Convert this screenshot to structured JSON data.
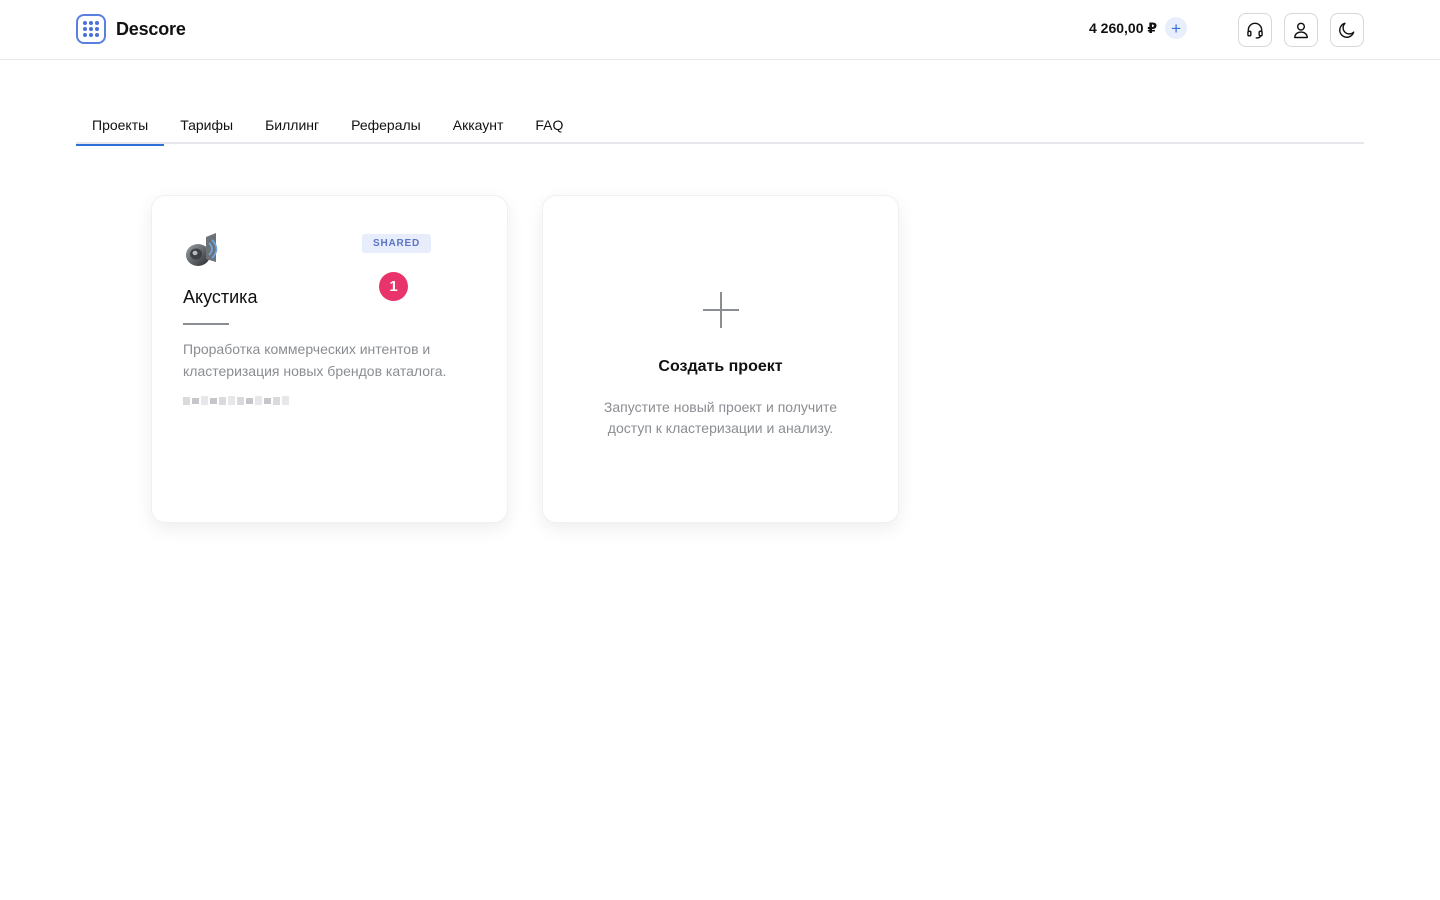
{
  "header": {
    "app_name": "Descore",
    "balance": "4 260,00 ₽",
    "balance_add_icon": "plus-icon",
    "actions": [
      {
        "icon": "headset-icon"
      },
      {
        "icon": "user-icon"
      },
      {
        "icon": "moon-icon"
      }
    ]
  },
  "tabs": [
    {
      "label": "Проекты",
      "active": true
    },
    {
      "label": "Тарифы",
      "active": false
    },
    {
      "label": "Биллинг",
      "active": false
    },
    {
      "label": "Рефералы",
      "active": false
    },
    {
      "label": "Аккаунт",
      "active": false
    },
    {
      "label": "FAQ",
      "active": false
    }
  ],
  "projects": [
    {
      "icon": "speaker-icon",
      "badge": "SHARED",
      "count": "1",
      "title": "Акустика",
      "description": "Проработка коммерческих интентов и кластеризация новых брендов каталога."
    }
  ],
  "create_card": {
    "icon": "plus-icon",
    "title": "Создать проект",
    "description": "Запустите новый проект и получите доступ к кластеризации и анализу."
  },
  "colors": {
    "accent": "#2f6fd8",
    "badge_bg": "#e8edfb",
    "count_badge": "#e8336b",
    "muted_text": "#8a8d92"
  }
}
